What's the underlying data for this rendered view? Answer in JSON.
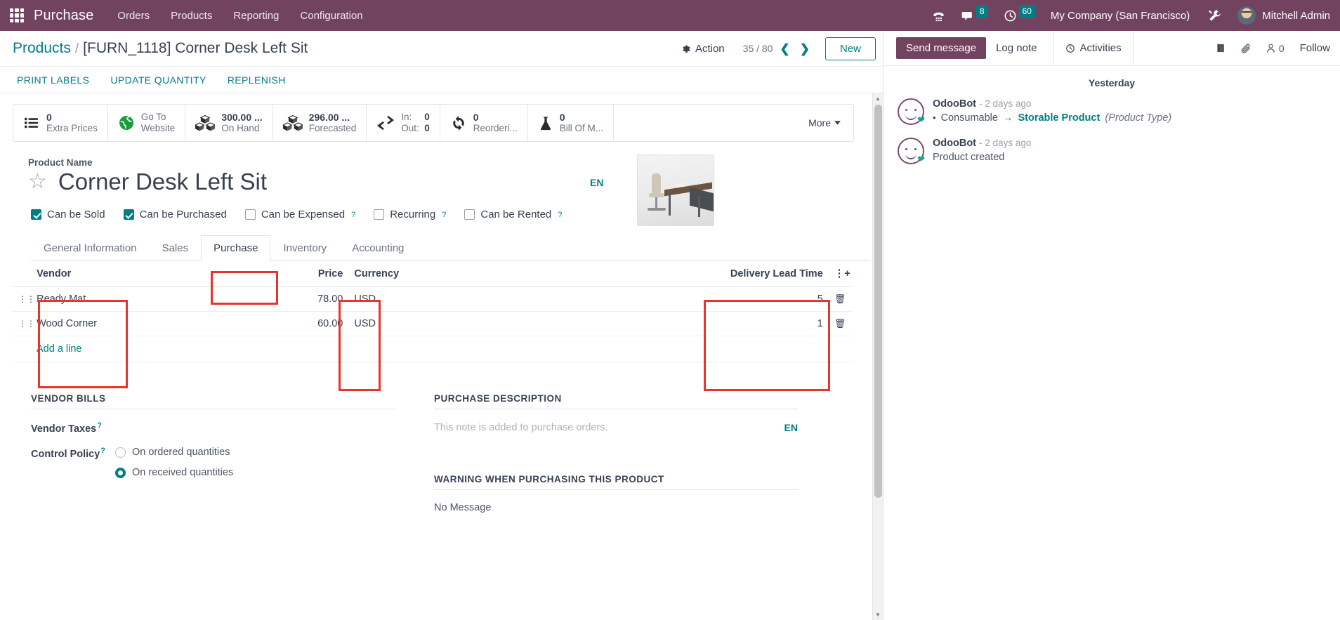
{
  "navbar": {
    "apps_icon": "apps-grid-icon",
    "brand": "Purchase",
    "menus": [
      "Orders",
      "Products",
      "Reporting",
      "Configuration"
    ],
    "dialpad_icon": "dialpad-icon",
    "messages_icon": "messages-icon",
    "messages_count": "8",
    "activities_icon": "clock-icon",
    "activities_count": "60",
    "company": "My Company (San Francisco)",
    "tools_icon": "tools-icon",
    "avatar": "user-avatar",
    "user": "Mitchell Admin",
    "brand_color": "#71435f",
    "badge_color": "#017e84"
  },
  "control_panel": {
    "breadcrumb_root": "Products",
    "breadcrumb_sep": "/",
    "breadcrumb_current": "[FURN_1118] Corner Desk Left Sit",
    "action_icon": "gear-icon",
    "action_label": "Action",
    "pager": "35 / 80",
    "prev_icon": "chevron-left-icon",
    "next_icon": "chevron-right-icon",
    "new_label": "New",
    "buttons": [
      "PRINT LABELS",
      "UPDATE QUANTITY",
      "REPLENISH"
    ]
  },
  "stat_buttons": [
    {
      "icon": "list-icon",
      "value": "0",
      "label": "Extra Prices"
    },
    {
      "icon": "globe-icon",
      "value": "Go To",
      "label": "Website"
    },
    {
      "icon": "boxes-icon",
      "value": "300.00 ...",
      "label": "On Hand"
    },
    {
      "icon": "boxes-icon",
      "value": "296.00 ...",
      "label": "Forecasted"
    },
    {
      "icon": "exchange-icon",
      "in_label": "In:",
      "in_value": "0",
      "out_label": "Out:",
      "out_value": "0"
    },
    {
      "icon": "refresh-icon",
      "value": "0",
      "label": "Reorderi..."
    },
    {
      "icon": "flask-icon",
      "value": "0",
      "label": "Bill Of M..."
    }
  ],
  "more_button": {
    "label": "More",
    "icon": "caret-down-icon"
  },
  "product": {
    "name_label": "Product Name",
    "star_icon": "star-icon",
    "name": "Corner Desk Left Sit",
    "lang_badge": "EN",
    "image_alt": "corner-desk-photo"
  },
  "checkboxes": [
    {
      "label": "Can be Sold",
      "checked": true,
      "help": false
    },
    {
      "label": "Can be Purchased",
      "checked": true,
      "help": false
    },
    {
      "label": "Can be Expensed",
      "checked": false,
      "help": true
    },
    {
      "label": "Recurring",
      "checked": false,
      "help": true
    },
    {
      "label": "Can be Rented",
      "checked": false,
      "help": true
    }
  ],
  "tabs": [
    {
      "label": "General Information",
      "active": false
    },
    {
      "label": "Sales",
      "active": false
    },
    {
      "label": "Purchase",
      "active": true
    },
    {
      "label": "Inventory",
      "active": false
    },
    {
      "label": "Accounting",
      "active": false
    }
  ],
  "vendor_table": {
    "headers": [
      "Vendor",
      "Price",
      "Currency",
      "Delivery Lead Time"
    ],
    "optional_icon": "column-options-icon",
    "rows": [
      {
        "handle": "drag-handle",
        "vendor": "Ready Mat",
        "price": "78.00",
        "currency": "USD",
        "lead_time": "5",
        "trash": "trash-icon"
      },
      {
        "handle": "drag-handle",
        "vendor": "Wood Corner",
        "price": "60.00",
        "currency": "USD",
        "lead_time": "1",
        "trash": "trash-icon"
      }
    ],
    "add_line": "Add a line"
  },
  "vendor_bills": {
    "title": "VENDOR BILLS",
    "vendor_taxes_label": "Vendor Taxes",
    "vendor_taxes_value": "",
    "control_policy_label": "Control Policy",
    "options": [
      {
        "label": "On ordered quantities",
        "selected": false
      },
      {
        "label": "On received quantities",
        "selected": true
      }
    ]
  },
  "purchase_description": {
    "title": "PURCHASE DESCRIPTION",
    "placeholder": "This note is added to purchase orders.",
    "lang_badge": "EN"
  },
  "warning_section": {
    "title": "WARNING WHEN PURCHASING THIS PRODUCT",
    "value": "No Message"
  },
  "chatter": {
    "send_message": "Send message",
    "log_note": "Log note",
    "activities_icon": "clock-icon",
    "activities": "Activities",
    "book_icon": "book-icon",
    "attachment_icon": "paperclip-icon",
    "followers_icon": "user-icon",
    "followers_count": "0",
    "follow": "Follow",
    "day_separator": "Yesterday",
    "messages": [
      {
        "avatar": "odoobot-avatar",
        "author": "OdooBot",
        "time": "- 2 days ago",
        "tracking": {
          "bullet": "•",
          "old": "Consumable",
          "arrow": "→",
          "new": "Storable Product",
          "field": "(Product Type)"
        }
      },
      {
        "avatar": "odoobot-avatar",
        "author": "OdooBot",
        "time": "- 2 days ago",
        "text": "Product created"
      }
    ]
  },
  "annotations": {
    "color": "#e8342a",
    "boxes": [
      "purchase-tab",
      "vendor-column",
      "price-column",
      "delivery-lead-time-column"
    ]
  }
}
